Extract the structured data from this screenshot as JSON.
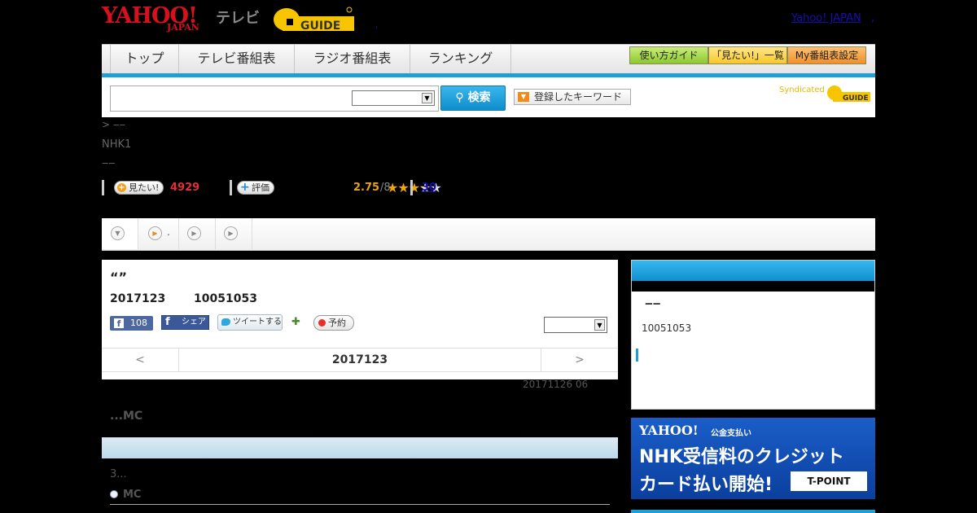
{
  "header": {
    "yahoo_logo": "YAHOO!",
    "yahoo_sub": "JAPAN",
    "tv_label": "テレビ",
    "gguide_logo": "G-GUIDE",
    "yahoo_japan_link": "Yahoo! JAPAN",
    "link_sep": ",",
    "dot": ","
  },
  "nav": {
    "tabs": [
      "トップ",
      "テレビ番組表",
      "ラジオ番組表",
      "ランキング"
    ],
    "right_buttons": [
      "使い方ガイド",
      "「見たい!」一覧",
      "My番組表設定"
    ],
    "colors": {
      "accent": "#1d9fd8",
      "guide_btn": "#a8d84a",
      "fav_btn": "#ffd24a",
      "my_btn": "#f6a23c"
    }
  },
  "search": {
    "input_value": "",
    "select_value": "",
    "button_label": "検索",
    "keyword_button": "登録したキーワード",
    "syndicated": "Syndicated"
  },
  "program": {
    "breadcrumb": "> ‒‒",
    "channel": "NHK1",
    "title": "‒‒",
    "watch_label": "見たい!",
    "watch_count": "4929",
    "rate_label": "評価",
    "rating": "2.75",
    "rating_max": "/8",
    "rating_stars": 2.75,
    "review_count": "30"
  },
  "subtabs": {
    "items": [
      "",
      ".",
      "",
      ""
    ]
  },
  "main": {
    "quote": "“”",
    "air_date": "2017123",
    "air_time": "10051053",
    "fb_like_count": "108",
    "fb_share_label": "シェア",
    "tweet_label": "ツイートする",
    "reserve_label": "予約",
    "select_value": "",
    "date_prev": "<",
    "date_current": "2017123",
    "date_next": ">",
    "updated": "20171126  06",
    "mc_heading": "...MC",
    "episode_text": "3...",
    "mc_label": "MC"
  },
  "side": {
    "dash": "‒‒",
    "time": "10051053"
  },
  "ad": {
    "yahoo": "YAHOO!",
    "pay": "公金支払い",
    "line1": "NHK受信料のクレジット",
    "line2": "カード払い開始!",
    "tpoint": "T-POINT"
  }
}
